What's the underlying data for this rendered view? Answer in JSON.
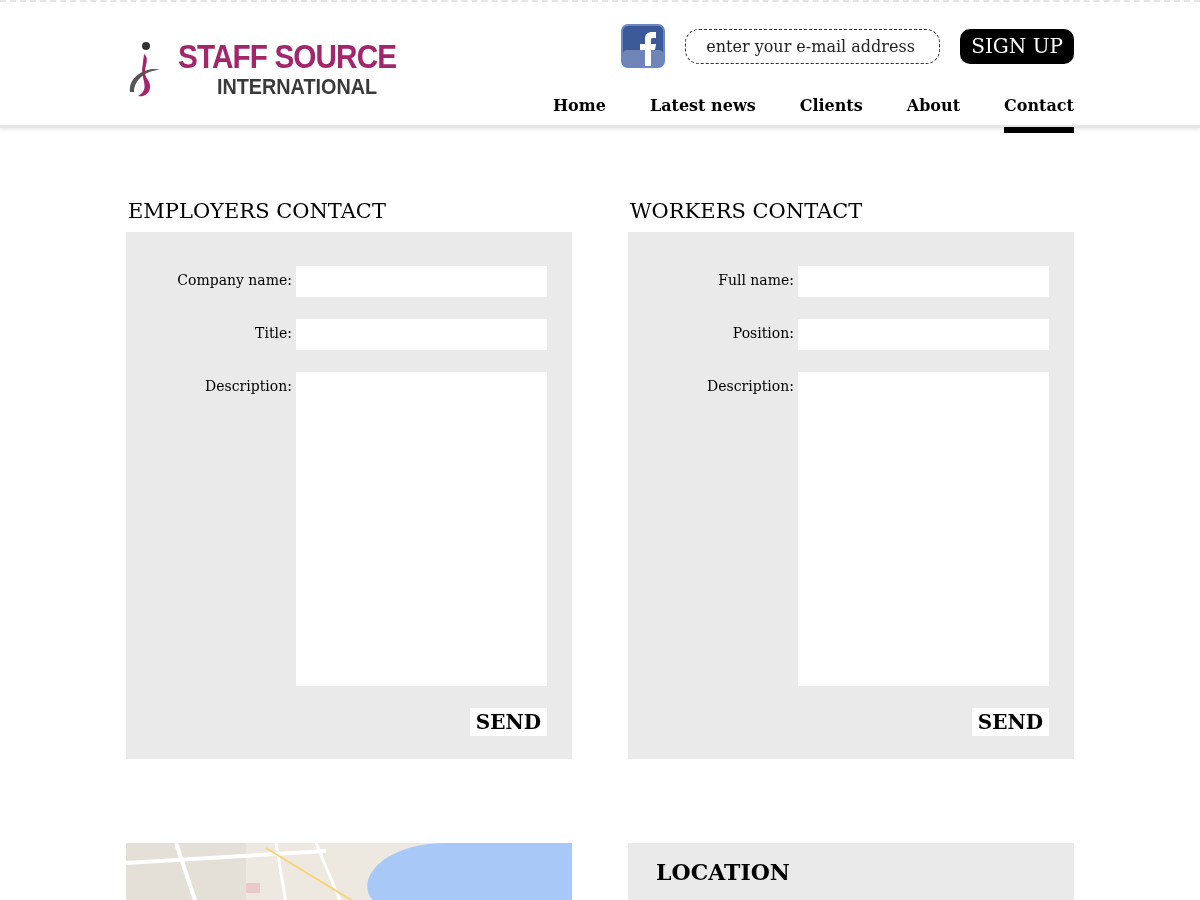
{
  "logo": {
    "line_1": "STAFF SOURCE",
    "line_2": "INTERNATIONAL"
  },
  "signup": {
    "placeholder": "enter your e-mail address",
    "button": "SIGN UP"
  },
  "nav": [
    {
      "label": "Home",
      "selected": false
    },
    {
      "label": "Latest news",
      "selected": false
    },
    {
      "label": "Clients",
      "selected": false
    },
    {
      "label": "About",
      "selected": false
    },
    {
      "label": "Contact",
      "selected": true
    }
  ],
  "forms": [
    {
      "title": "EMPLOYERS CONTACT",
      "fields": [
        {
          "kind": "input",
          "label": "Company name:"
        },
        {
          "kind": "input",
          "label": "Title:"
        },
        {
          "kind": "textarea",
          "label": "Description:"
        }
      ],
      "button": "SEND"
    },
    {
      "title": "WORKERS CONTACT",
      "fields": [
        {
          "kind": "input",
          "label": "Full name:"
        },
        {
          "kind": "input",
          "label": "Position:"
        },
        {
          "kind": "textarea",
          "label": "Description:"
        }
      ],
      "button": "SEND"
    }
  ],
  "location": {
    "title": "LOCATION"
  }
}
